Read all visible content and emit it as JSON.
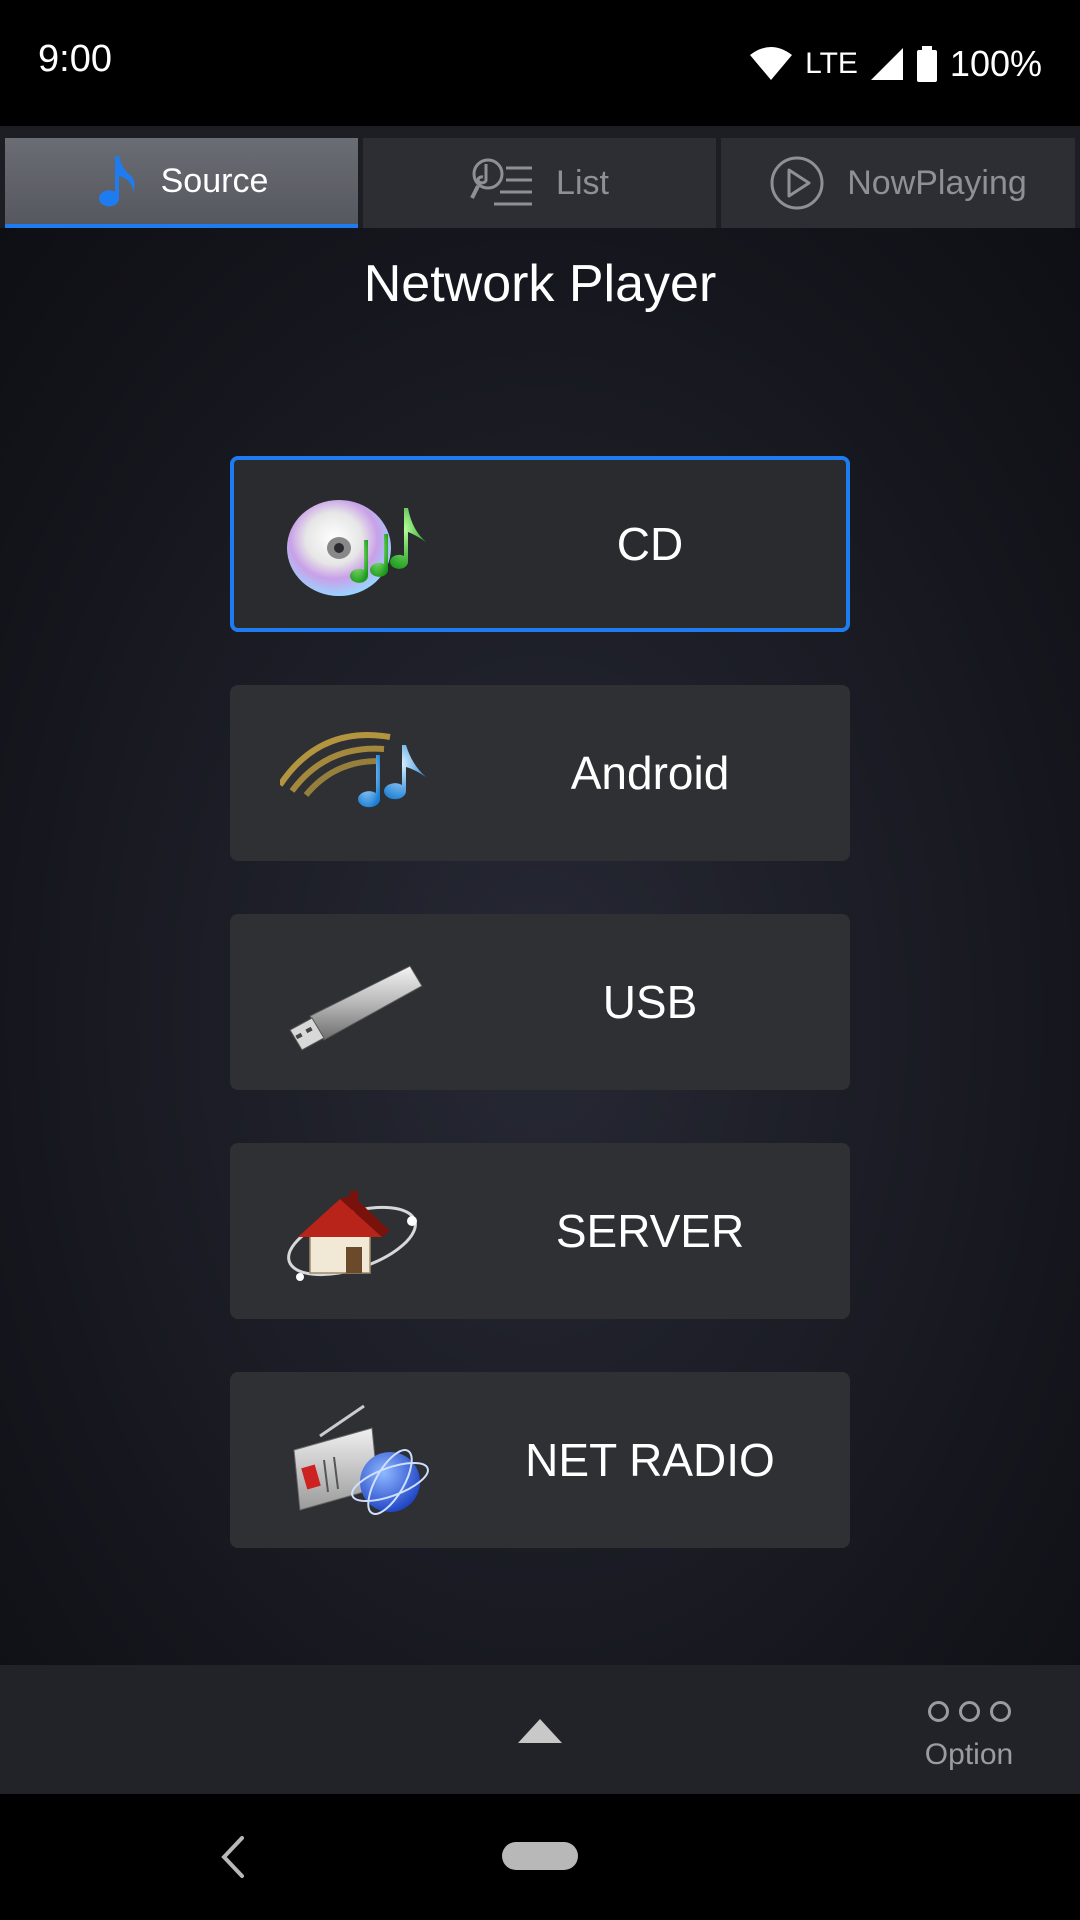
{
  "status_bar": {
    "time": "9:00",
    "network": "LTE",
    "battery": "100%"
  },
  "tabs": [
    {
      "label": "Source",
      "icon": "music-note-icon",
      "active": true
    },
    {
      "label": "List",
      "icon": "list-search-icon",
      "active": false
    },
    {
      "label": "NowPlaying",
      "icon": "play-circle-icon",
      "active": false
    }
  ],
  "page_title": "Network Player",
  "sources": [
    {
      "label": "CD",
      "icon": "cd-music-icon",
      "selected": true
    },
    {
      "label": "Android",
      "icon": "android-music-icon",
      "selected": false
    },
    {
      "label": "USB",
      "icon": "usb-drive-icon",
      "selected": false
    },
    {
      "label": "SERVER",
      "icon": "home-server-icon",
      "selected": false
    },
    {
      "label": "NET RADIO",
      "icon": "net-radio-icon",
      "selected": false
    }
  ],
  "toolbar": {
    "up_icon": "triangle-up-icon",
    "option_label": "Option"
  },
  "colors": {
    "accent": "#1e7cf0",
    "button_bg": "#2f3034",
    "background": "#191a22"
  }
}
